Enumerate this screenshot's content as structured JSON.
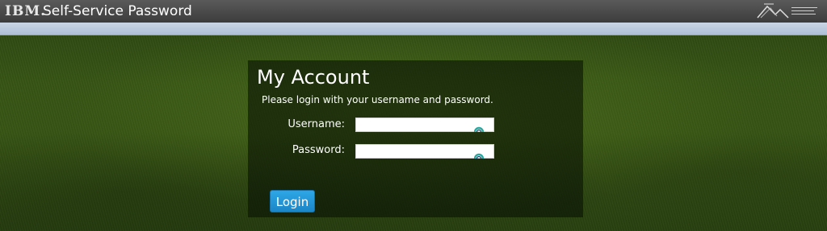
{
  "header": {
    "brand": "IBM.",
    "title": "Self-Service Password",
    "org_logo_icon": "organization-logo-icon"
  },
  "login_panel": {
    "title": "My Account",
    "subtitle": "Please login with your username and password.",
    "username_label": "Username:",
    "username_value": "",
    "password_label": "Password:",
    "password_value": "",
    "field_icon": "password-manager-key-icon",
    "login_button": "Login"
  },
  "colors": {
    "topbar": "#444444",
    "separator": "#bccbe0",
    "login_button": "#2496d8",
    "field_icon": "#2aa8a0"
  }
}
